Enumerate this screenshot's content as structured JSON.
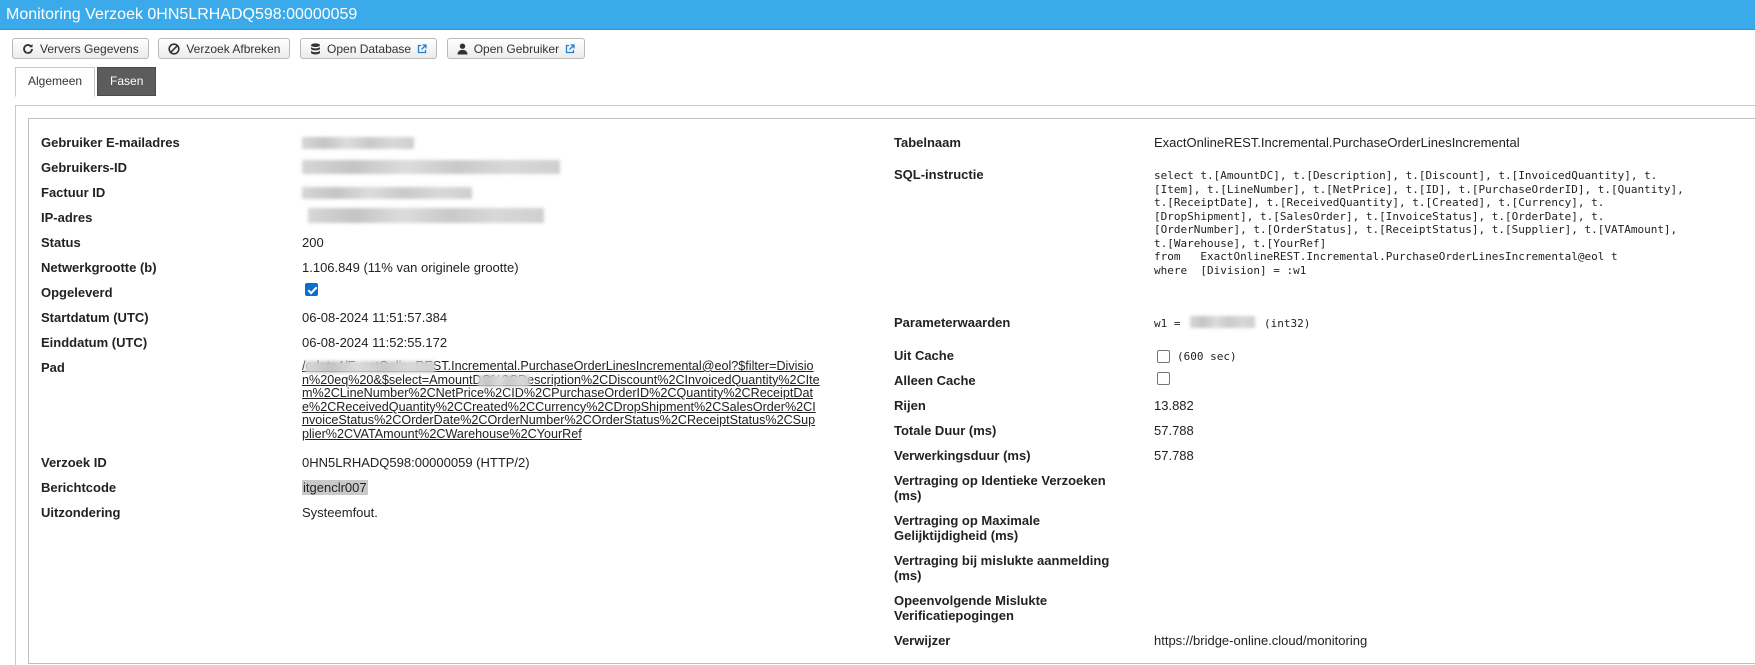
{
  "window": {
    "title": "Monitoring Verzoek 0HN5LRHADQ598:00000059"
  },
  "toolbar": {
    "buttons": [
      {
        "label": "Ververs Gegevens",
        "icon": "refresh-icon"
      },
      {
        "label": "Verzoek Afbreken",
        "icon": "ban-icon"
      },
      {
        "label": "Open Database",
        "icon": "database-icon",
        "external": "external-link-icon"
      },
      {
        "label": "Open Gebruiker",
        "icon": "user-icon",
        "external": "external-link-icon"
      }
    ]
  },
  "tabs": [
    {
      "label": "Algemeen",
      "active": true
    },
    {
      "label": "Fasen",
      "active": false
    }
  ],
  "left": {
    "email_label": "Gebruiker E-mailadres",
    "user_id_label": "Gebruikers-ID",
    "invoice_id_label": "Factuur ID",
    "ip_label": "IP-adres",
    "status_label": "Status",
    "status_value": "200",
    "network_size_label": "Netwerkgrootte (b)",
    "network_size_value": "1.106.849 (11% van originele grootte)",
    "delivered_label": "Opgeleverd",
    "delivered_checked": true,
    "start_label": "Startdatum (UTC)",
    "start_value": "06-08-2024 11:51:57.384",
    "end_label": "Einddatum (UTC)",
    "end_value": "06-08-2024 11:52:55.172",
    "path_label": "Pad",
    "path_value": "/odata4/ExactOnlineREST.Incremental.PurchaseOrderLinesIncremental@eol?$filter=Division%20eq%20&$select=AmountDC%2CDescription%2CDiscount%2CInvoicedQuantity%2CItem%2CLineNumber%2CNetPrice%2CID%2CPurchaseOrderID%2CQuantity%2CReceiptDate%2CReceivedQuantity%2CCreated%2CCurrency%2CDropShipment%2CSalesOrder%2CInvoiceStatus%2COrderDate%2COrderNumber%2COrderStatus%2CReceiptStatus%2CSupplier%2CVATAmount%2CWarehouse%2CYourRef",
    "request_id_label": "Verzoek ID",
    "request_id_value": "0HN5LRHADQ598:00000059 (HTTP/2)",
    "message_code_label": "Berichtcode",
    "message_code_value": "itgenclr007",
    "exception_label": "Uitzondering",
    "exception_value": "Systeemfout."
  },
  "right": {
    "table_label": "Tabelnaam",
    "table_value": "ExactOnlineREST.Incremental.PurchaseOrderLinesIncremental",
    "sql_label": "SQL-instructie",
    "sql_lines": [
      "select t.[AmountDC], t.[Description], t.[Discount], t.[InvoicedQuantity], t.",
      "[Item], t.[LineNumber], t.[NetPrice], t.[ID], t.[PurchaseOrderID], t.[Quantity],",
      "t.[ReceiptDate], t.[ReceivedQuantity], t.[Created], t.[Currency], t.",
      "[DropShipment], t.[SalesOrder], t.[InvoiceStatus], t.[OrderDate], t.",
      "[OrderNumber], t.[OrderStatus], t.[ReceiptStatus], t.[Supplier], t.[VATAmount],",
      "t.[Warehouse], t.[YourRef]",
      "from   ExactOnlineREST.Incremental.PurchaseOrderLinesIncremental@eol t",
      "where  [Division] = :w1"
    ],
    "params_label": "Parameterwaarden",
    "params_prefix": "w1 =",
    "params_suffix": "(int32)",
    "from_cache_label": "Uit Cache",
    "from_cache_checked": false,
    "from_cache_note": "(600 sec)",
    "only_cache_label": "Alleen Cache",
    "only_cache_checked": false,
    "rows_label": "Rijen",
    "rows_value": "13.882",
    "total_duration_label": "Totale Duur (ms)",
    "total_duration_value": "57.788",
    "processing_label": "Verwerkingsduur (ms)",
    "processing_value": "57.788",
    "delay_identical_label_1": "Vertraging op Identieke Verzoeken",
    "delay_identical_label_2": "(ms)",
    "delay_max_label_1": "Vertraging op Maximale",
    "delay_max_label_2": "Gelijktijdigheid (ms)",
    "delay_failed_label_1": "Vertraging bij mislukte aanmelding",
    "delay_failed_label_2": "(ms)",
    "consecutive_label_1": "Opeenvolgende Mislukte",
    "consecutive_label_2": "Verificatiepogingen",
    "referrer_label": "Verwijzer",
    "referrer_value": "https://bridge-online.cloud/monitoring"
  }
}
